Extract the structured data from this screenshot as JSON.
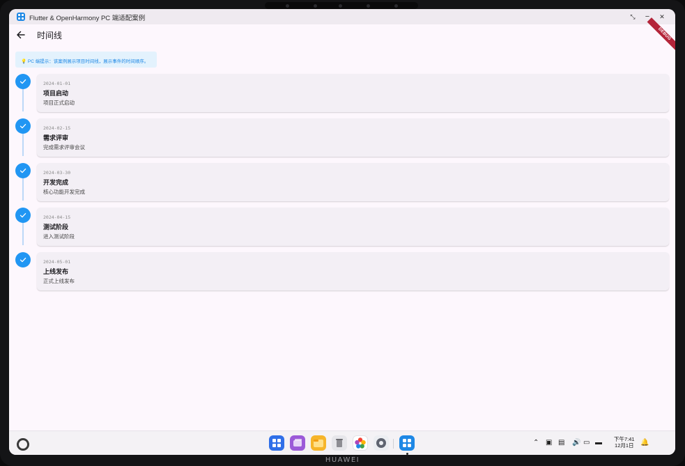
{
  "device": {
    "brand": "HUAWEI"
  },
  "window": {
    "title": "Flutter & OpenHarmony PC 端适配案例",
    "buttons": {
      "restore": "⤡",
      "minimize": "−",
      "close": "✕"
    }
  },
  "appbar": {
    "title": "时间线",
    "debug_banner": "DEBUG"
  },
  "tip": {
    "text": "💡 PC 端提示：该案例展示项目时间线，展示事件的时间顺序。"
  },
  "timeline": {
    "accent_color": "#2196F3",
    "items": [
      {
        "date": "2024-01-01",
        "title": "项目启动",
        "description": "项目正式启动",
        "done": true
      },
      {
        "date": "2024-02-15",
        "title": "需求评审",
        "description": "完成需求评审会议",
        "done": true
      },
      {
        "date": "2024-03-30",
        "title": "开发完成",
        "description": "核心功能开发完成",
        "done": true
      },
      {
        "date": "2024-04-15",
        "title": "测试阶段",
        "description": "进入测试阶段",
        "done": true
      },
      {
        "date": "2024-05-01",
        "title": "上线发布",
        "description": "正式上线发布",
        "done": true
      }
    ]
  },
  "taskbar": {
    "dock": [
      {
        "name": "launcher-icon",
        "color": "#2f6fe8"
      },
      {
        "name": "multitask-icon",
        "color": "#9b5ad8"
      },
      {
        "name": "files-icon",
        "color": "#f6b52a"
      },
      {
        "name": "trash-icon",
        "color": "#d9d9dc"
      },
      {
        "name": "gallery-icon",
        "color": "#ffffff"
      },
      {
        "name": "settings-icon",
        "color": "#6f7480"
      },
      {
        "name": "flutter-app-icon",
        "color": "#1e88e5"
      }
    ],
    "clock": {
      "time": "下午7:41",
      "date": "12月1日"
    }
  }
}
